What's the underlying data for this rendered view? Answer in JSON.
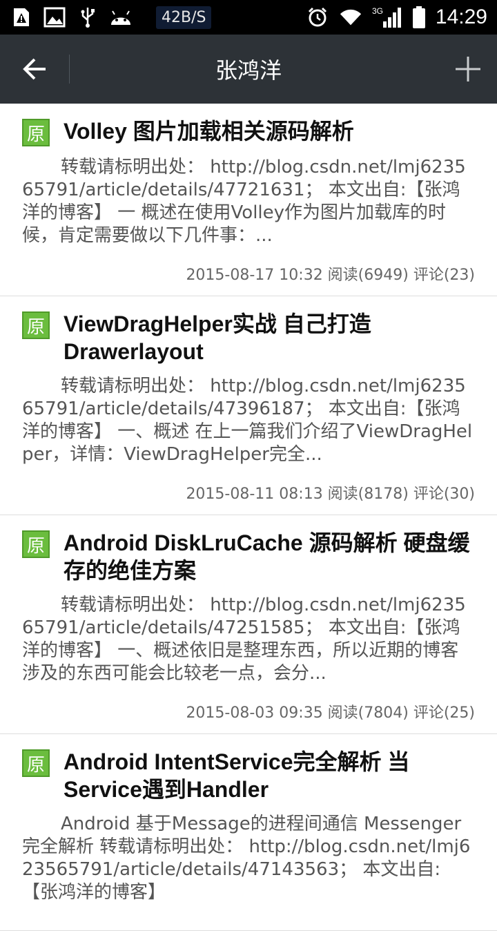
{
  "statusbar": {
    "speed": "42B/S",
    "network": "3G",
    "time": "14:29"
  },
  "actionbar": {
    "title": "张鸿洋"
  },
  "articles": [
    {
      "badge": "原",
      "title": "Volley 图片加载相关源码解析",
      "summary": "转载请标明出处： http://blog.csdn.net/lmj623565791/article/details/47721631； 本文出自:【张鸿洋的博客】 一 概述在使用Volley作为图片加载库的时候，肯定需要做以下几件事：...",
      "meta": "2015-08-17 10:32 阅读(6949) 评论(23)"
    },
    {
      "badge": "原",
      "title": "ViewDragHelper实战 自己打造Drawerlayout",
      "summary": "转载请标明出处： http://blog.csdn.net/lmj623565791/article/details/47396187； 本文出自:【张鸿洋的博客】 一、概述 在上一篇我们介绍了ViewDragHelper，详情：ViewDragHelper完全...",
      "meta": "2015-08-11 08:13 阅读(8178) 评论(30)"
    },
    {
      "badge": "原",
      "title": "Android DiskLruCache 源码解析 硬盘缓存的绝佳方案",
      "summary": "转载请标明出处： http://blog.csdn.net/lmj623565791/article/details/47251585； 本文出自:【张鸿洋的博客】 一、概述依旧是整理东西，所以近期的博客涉及的东西可能会比较老一点，会分...",
      "meta": "2015-08-03 09:35 阅读(7804) 评论(25)"
    },
    {
      "badge": "原",
      "title": "Android IntentService完全解析 当Service遇到Handler",
      "summary": "Android 基于Message的进程间通信 Messenger完全解析 转载请标明出处： http://blog.csdn.net/lmj623565791/article/details/47143563； 本文出自:【张鸿洋的博客】",
      "meta": ""
    }
  ]
}
